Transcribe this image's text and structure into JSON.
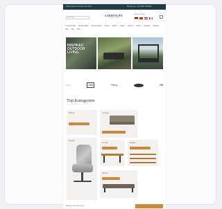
{
  "topbar": {
    "left_text": "Kostenloser Versand ab 50 €",
    "right_text": "Beratung: +49 000 000000"
  },
  "header": {
    "search_placeholder": "Suchen ...",
    "logo_name": "GARDENLIFE",
    "logo_tagline": "Outdoor Living",
    "contact_line": "Hilfe & Kontakt",
    "flags": [
      "de",
      "ch",
      "at",
      "fr"
    ]
  },
  "nav": {
    "items": [
      "Loungemöbel",
      "Gartenmöbel",
      "Sonnenschutz",
      "Tische",
      "Stühle",
      "Liegen",
      "Outdoor",
      "Küche",
      "Zubehör",
      "Marken",
      "Sale",
      "Neu",
      "Blog"
    ]
  },
  "hero": {
    "slide1_text": "INSPIRED OUTDOOR LIVING"
  },
  "brands": {
    "items": [
      "Brand",
      "COX",
      "Fatboy",
      "",
      "GH"
    ]
  },
  "categories": {
    "title": "Top Kategorien",
    "tiles": [
      {
        "label": "Stühle"
      },
      {
        "label": "Lounge"
      },
      {
        "label": "Sessel"
      },
      {
        "label": "Tische"
      },
      {
        "label": "Regale"
      },
      {
        "label": "Bänke"
      }
    ]
  },
  "footer": {
    "text": "Bleiben Sie informiert"
  }
}
